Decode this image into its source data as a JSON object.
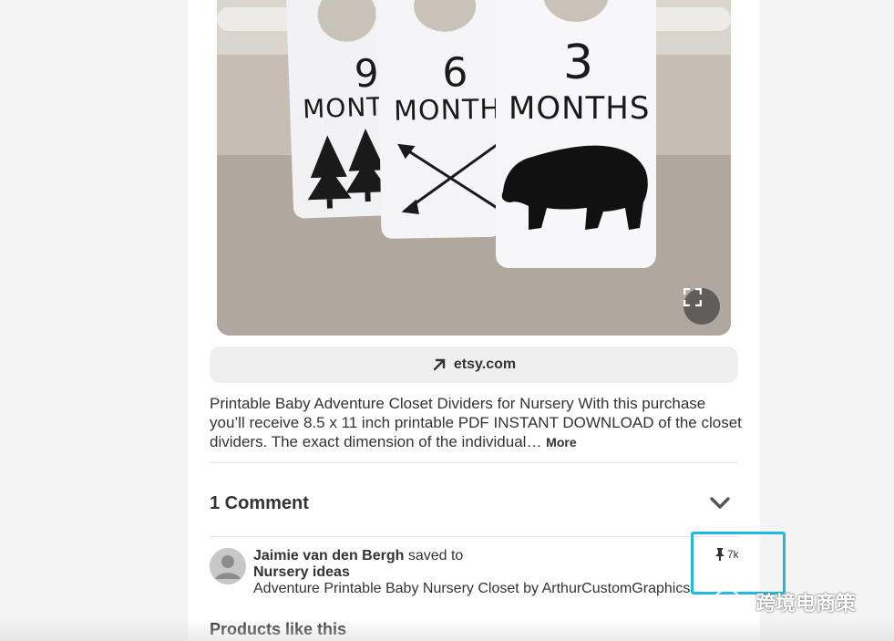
{
  "pin_image": {
    "tags": [
      {
        "number": "9",
        "word": "MONTHS"
      },
      {
        "number": "6",
        "word": "MONTHS"
      },
      {
        "number": "3",
        "word": "MONTHS"
      }
    ],
    "expand_icon": "expand-icon"
  },
  "source_link": {
    "icon": "arrow-up-right-icon",
    "label": "etsy.com"
  },
  "description": {
    "text": "Printable Baby Adventure Closet Dividers for Nursery With this purchase you’ll receive 8.5 x 11 inch printable PDF INSTANT DOWNLOAD of the closet dividers. The exact dimension of the individual…",
    "more_label": "More"
  },
  "comments": {
    "title": "1 Comment",
    "toggle_icon": "chevron-down-icon"
  },
  "save_activity": {
    "user_name": "Jaimie van den Bergh",
    "action": "saved to",
    "board": "Nursery ideas",
    "pin_title": "Adventure Printable Baby Nursery Closet by ArthurCustomGraphics",
    "pin_icon": "pushpin-icon",
    "pin_count": "7k"
  },
  "products_section": {
    "title": "Products like this"
  },
  "watermark": {
    "text": "跨境电商策",
    "icon": "wechat-icon"
  },
  "colors": {
    "highlight": "#22b9e0",
    "text": "#333333",
    "link_bar_bg": "#efefef"
  }
}
